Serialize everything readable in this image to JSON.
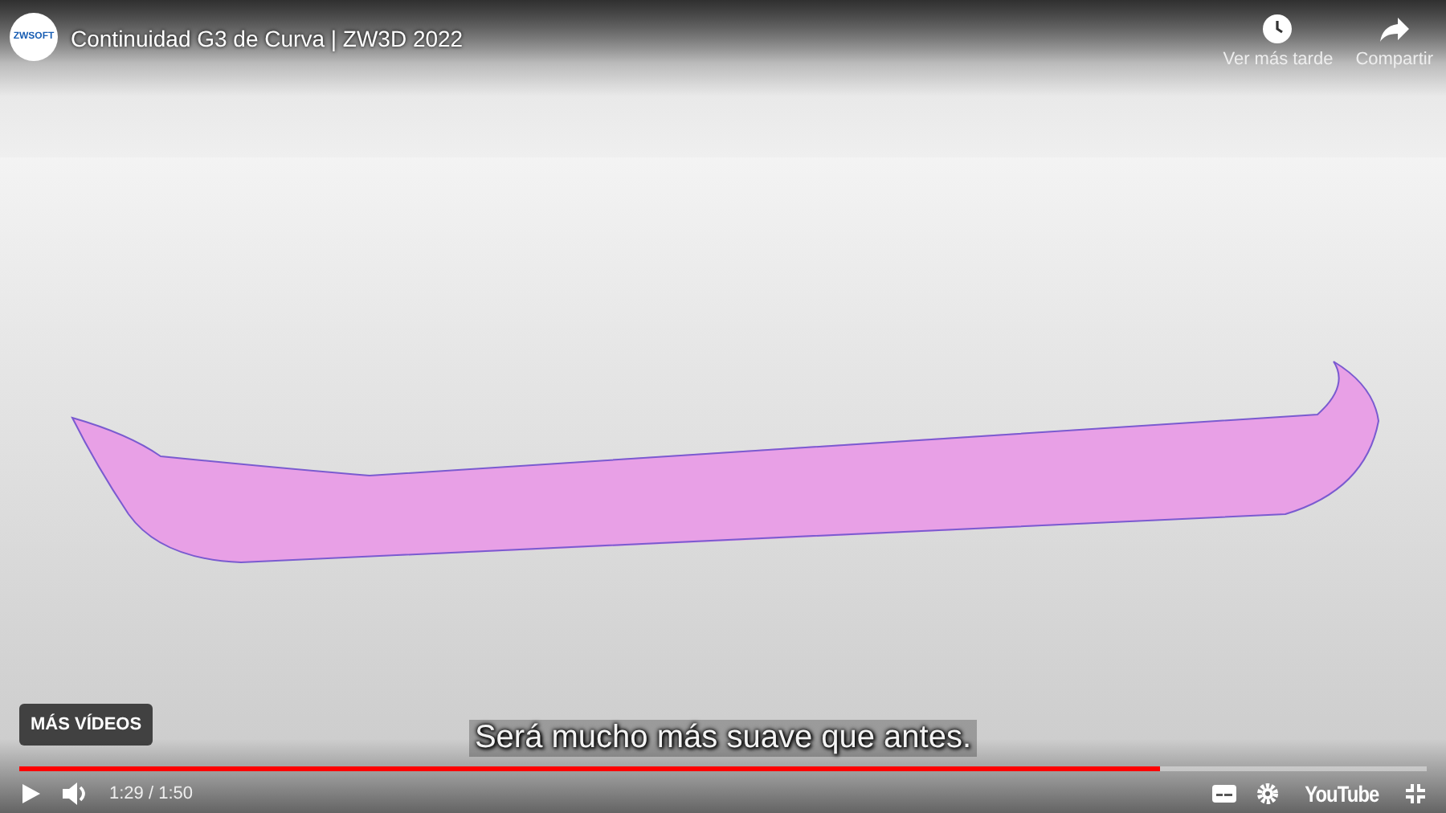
{
  "video": {
    "title": "Continuidad G3 de Curva | ZW3D 2022",
    "channel_logo": "ZWSOFT",
    "top_actions": [
      {
        "kind": "watch_later",
        "label": "Ver más tarde"
      },
      {
        "kind": "share",
        "label": "Compartir"
      }
    ],
    "more_videos": "MÁS VÍDEOS",
    "subtitle": "Será mucho más suave que antes.",
    "progress": {
      "level": 0.81
    },
    "controls": {
      "playing": false,
      "muted": false,
      "time": "1:29 / 1:50",
      "brand": "YouTube"
    }
  }
}
